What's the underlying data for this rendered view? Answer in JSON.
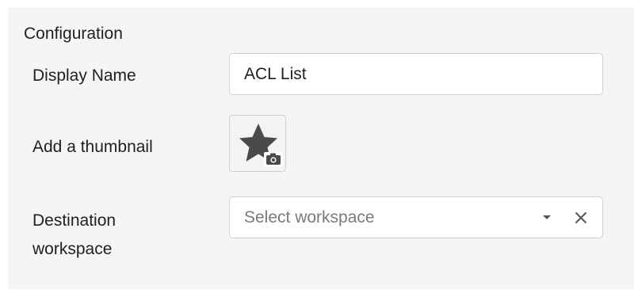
{
  "configuration": {
    "title": "Configuration",
    "display_name": {
      "label": "Display Name",
      "value": "ACL List"
    },
    "thumbnail": {
      "label": "Add a thumbnail",
      "icon": "star-icon",
      "overlay_icon": "camera-icon"
    },
    "destination": {
      "label": "Destination workspace",
      "placeholder": "Select workspace",
      "dropdown_icon": "caret-down-icon",
      "clear_icon": "close-icon"
    }
  },
  "colors": {
    "panel_bg": "#f5f5f5",
    "input_border": "#cfcfcf",
    "text": "#1f1f1f",
    "placeholder": "#7a7a7a",
    "star": "#4a4a4a"
  }
}
